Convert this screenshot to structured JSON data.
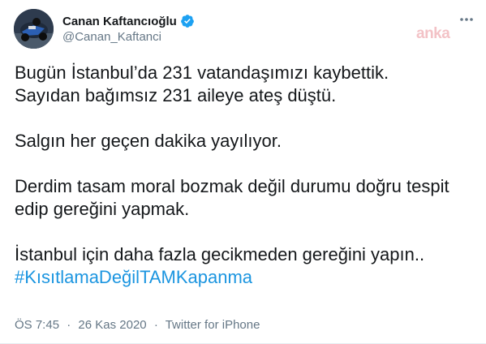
{
  "author": {
    "display_name": "Canan Kaftancıoğlu",
    "handle": "@Canan_Kaftanci",
    "verified": true,
    "verified_color": "#1da1f2"
  },
  "watermark": "anka",
  "tweet": {
    "paragraphs": [
      [
        "Bugün İstanbul’da 231 vatandaşımızı kaybettik.",
        "Sayıdan bağımsız 231 aileye ateş düştü."
      ],
      [
        "Salgın her geçen dakika yayılıyor."
      ],
      [
        "Derdim tasam moral bozmak değil durumu doğru tespit",
        "edip gereğini yapmak."
      ],
      [
        "İstanbul için daha fazla gecikmeden gereğini yapın.."
      ]
    ],
    "hashtag": "#KısıtlamaDeğilTAMKapanma",
    "hashtag_color": "#1b95e0"
  },
  "meta": {
    "time": "ÖS 7:45",
    "separator": "·",
    "date": "26 Kas 2020",
    "source": "Twitter for iPhone"
  },
  "icons": {
    "verified": "verified-badge-icon",
    "more": "more-options-icon"
  }
}
